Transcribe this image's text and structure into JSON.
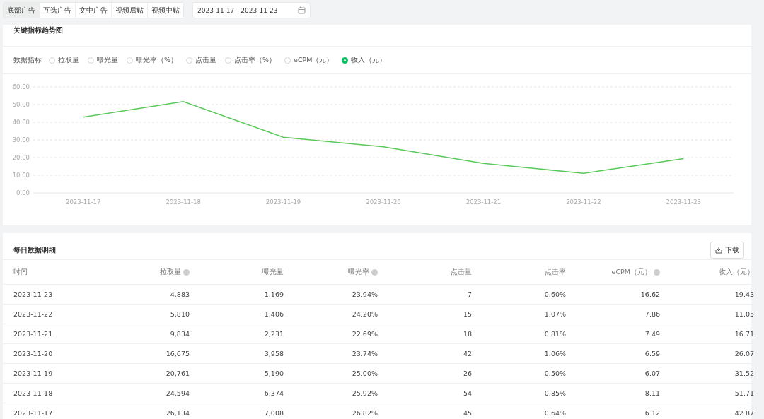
{
  "ad_tabs": [
    {
      "label": "底部广告",
      "selected": true
    },
    {
      "label": "互选广告",
      "selected": false
    },
    {
      "label": "文中广告",
      "selected": false
    },
    {
      "label": "视频后贴",
      "selected": false
    },
    {
      "label": "视频中贴",
      "selected": false
    }
  ],
  "date_range": {
    "value": "2023-11-17 - 2023-11-23"
  },
  "trend_card": {
    "title": "关键指标趋势图",
    "metrics_label": "数据指标",
    "metrics": [
      {
        "label": "拉取量",
        "selected": false
      },
      {
        "label": "曝光量",
        "selected": false
      },
      {
        "label": "曝光率（%）",
        "selected": false
      },
      {
        "label": "点击量",
        "selected": false
      },
      {
        "label": "点击率（%）",
        "selected": false
      },
      {
        "label": "eCPM（元）",
        "selected": false
      },
      {
        "label": "收入（元）",
        "selected": true
      }
    ],
    "chart_data": {
      "type": "line",
      "categories": [
        "2023-11-17",
        "2023-11-18",
        "2023-11-19",
        "2023-11-20",
        "2023-11-21",
        "2023-11-22",
        "2023-11-23"
      ],
      "series": [
        {
          "color": "#5ac85a",
          "values": [
            42.9,
            51.7,
            31.5,
            26.1,
            16.7,
            11.1,
            19.4
          ]
        }
      ],
      "grid": true,
      "ylim": [
        0,
        60
      ],
      "yticks": [
        {
          "value": 0,
          "label": "0.00"
        },
        {
          "value": 10,
          "label": "10.00"
        },
        {
          "value": 20,
          "label": "20.00"
        },
        {
          "value": 30,
          "label": "30.00"
        },
        {
          "value": 40,
          "label": "40.00"
        },
        {
          "value": 50,
          "label": "50.00"
        },
        {
          "value": 60,
          "label": "60.00"
        }
      ]
    }
  },
  "daily_card": {
    "title": "每日数据明细",
    "download_button": "下载",
    "columns": [
      {
        "label": "时间",
        "help": false
      },
      {
        "label": "拉取量",
        "help": true
      },
      {
        "label": "曝光量",
        "help": false
      },
      {
        "label": "曝光率",
        "help": true
      },
      {
        "label": "点击量",
        "help": false
      },
      {
        "label": "点击率",
        "help": false
      },
      {
        "label": "eCPM（元）",
        "help": true
      },
      {
        "label": "收入（元）",
        "help": false
      }
    ],
    "rows": [
      [
        "2023-11-23",
        "4,883",
        "1,169",
        "23.94%",
        "7",
        "0.60%",
        "16.62",
        "19.43"
      ],
      [
        "2023-11-22",
        "5,810",
        "1,406",
        "24.20%",
        "15",
        "1.07%",
        "7.86",
        "11.05"
      ],
      [
        "2023-11-21",
        "9,834",
        "2,231",
        "22.69%",
        "18",
        "0.81%",
        "7.49",
        "16.71"
      ],
      [
        "2023-11-20",
        "16,675",
        "3,958",
        "23.74%",
        "42",
        "1.06%",
        "6.59",
        "26.07"
      ],
      [
        "2023-11-19",
        "20,761",
        "5,190",
        "25.00%",
        "26",
        "0.50%",
        "6.07",
        "31.52"
      ],
      [
        "2023-11-18",
        "24,594",
        "6,374",
        "25.92%",
        "54",
        "0.85%",
        "8.11",
        "51.71"
      ],
      [
        "2023-11-17",
        "26,134",
        "7,008",
        "26.82%",
        "45",
        "0.64%",
        "6.12",
        "42.87"
      ]
    ]
  }
}
